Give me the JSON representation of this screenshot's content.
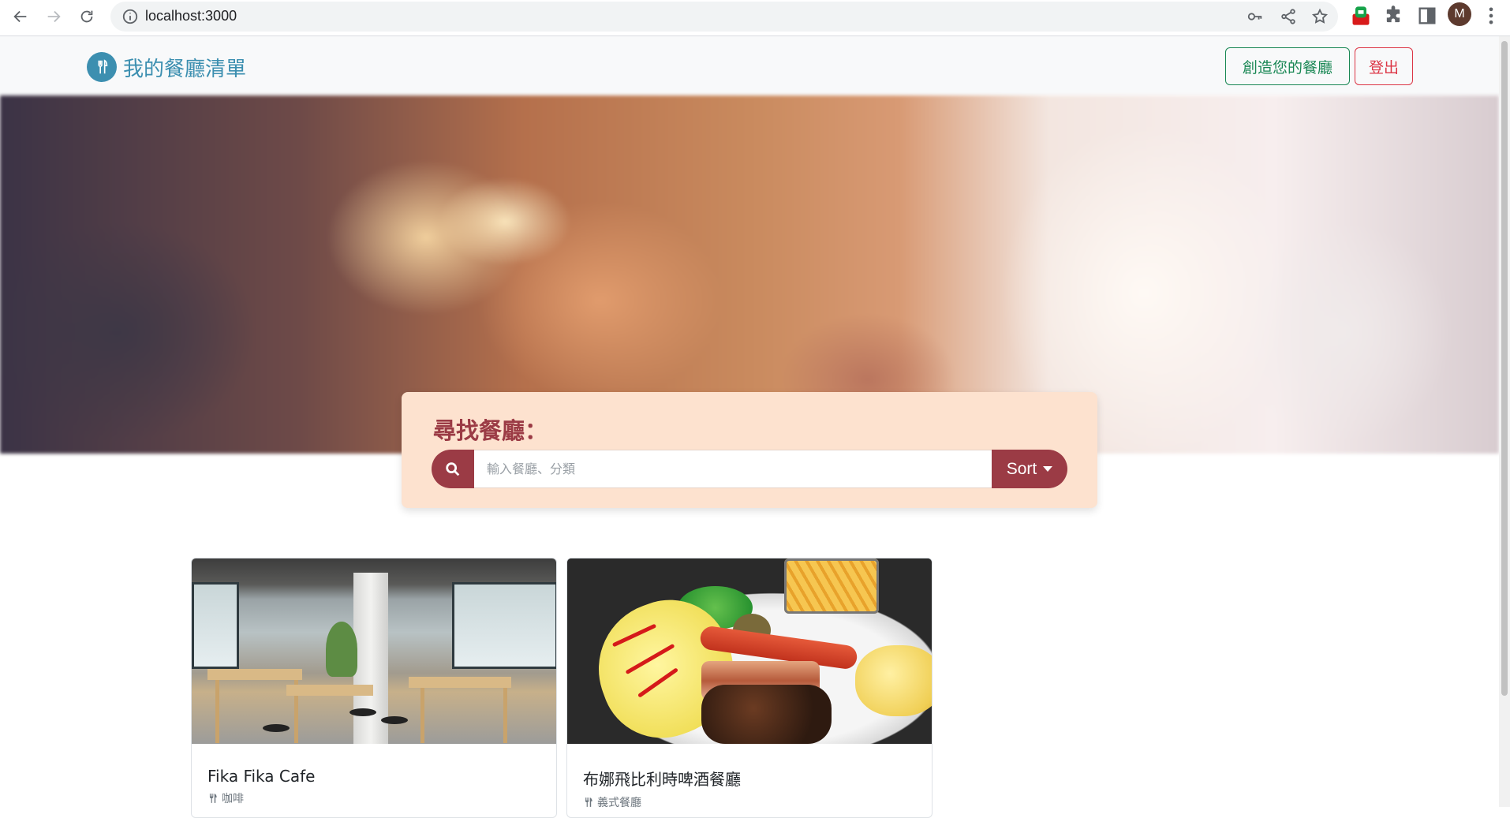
{
  "browser": {
    "url": "localhost:3000",
    "avatar_initial": "M"
  },
  "navbar": {
    "brand": "我的餐廳清單",
    "create_label": "創造您的餐廳",
    "logout_label": "登出"
  },
  "search": {
    "title": "尋找餐廳：",
    "placeholder": "輸入餐廳、分類",
    "sort_label": "Sort"
  },
  "restaurants": [
    {
      "name": "Fika Fika Cafe",
      "category": "咖啡"
    },
    {
      "name": "布娜飛比利時啤酒餐廳",
      "category": "義式餐廳"
    }
  ],
  "colors": {
    "brand": "#3c8fb0",
    "accent": "#9b3b45",
    "panel": "#fde2cf",
    "success": "#198754",
    "danger": "#dc3545"
  }
}
